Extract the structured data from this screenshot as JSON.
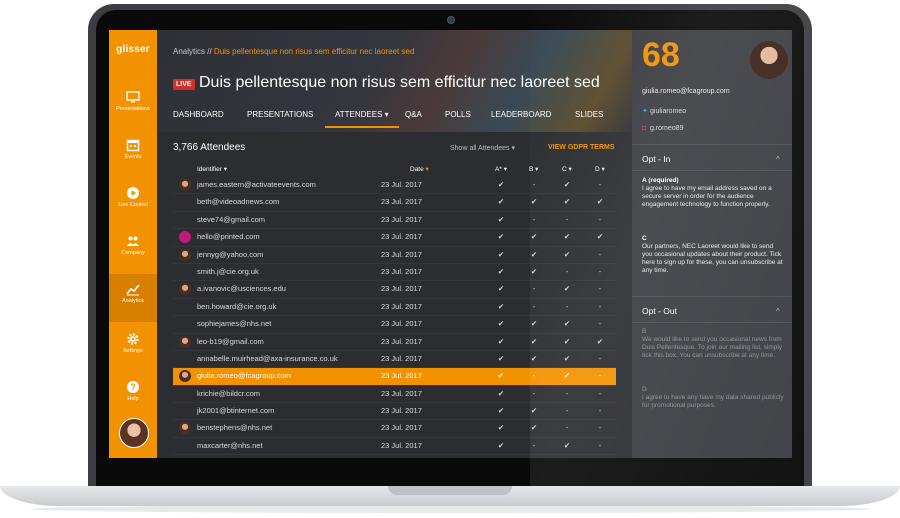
{
  "app": {
    "logo": "glisser"
  },
  "sidebar": {
    "items": [
      {
        "label": "Presentations",
        "icon": "monitor-icon"
      },
      {
        "label": "Events",
        "icon": "calendar-icon"
      },
      {
        "label": "Live Control",
        "icon": "play-icon"
      },
      {
        "label": "Company",
        "icon": "users-icon"
      },
      {
        "label": "Analytics",
        "icon": "chart-icon",
        "active": true
      },
      {
        "label": "Settings",
        "icon": "gear-icon"
      },
      {
        "label": "Help",
        "icon": "help-icon"
      }
    ]
  },
  "header": {
    "breadcrumb_root": "Analytics //",
    "breadcrumb_current": "Duis pellentesque non risus sem efficitur nec laoreet sed",
    "live_badge": "LIVE",
    "title": "Duis pellentesque non risus sem efficitur nec laoreet sed"
  },
  "tabs": [
    {
      "label": "DASHBOARD"
    },
    {
      "label": "PRESENTATIONS"
    },
    {
      "label": "ATTENDEES ▾",
      "active": true
    },
    {
      "label": "Q&A"
    },
    {
      "label": "POLLS"
    },
    {
      "label": "LEADERBOARD"
    },
    {
      "label": "SLIDES"
    }
  ],
  "attendees": {
    "count_label": "3,766 Attendees",
    "filter_label": "Show all Attendees ▾",
    "gdpr_link": "VIEW GDPR TERMS",
    "columns": {
      "identifier": "Identifier",
      "date": "Date",
      "a": "A*",
      "b": "B",
      "c": "C",
      "d": "D"
    },
    "rows": [
      {
        "identifier": "james.eastern@activateevents.com",
        "date": "23 Jul. 2017",
        "a": "✔",
        "b": "-",
        "c": "✔",
        "d": "-",
        "avatar": "photo"
      },
      {
        "identifier": "beth@videoadnews.com",
        "date": "23 Jul. 2017",
        "a": "✔",
        "b": "✔",
        "c": "✔",
        "d": "✔"
      },
      {
        "identifier": "steve74@gmail.com",
        "date": "23 Jul. 2017",
        "a": "✔",
        "b": "-",
        "c": "-",
        "d": "-"
      },
      {
        "identifier": "hello@printed.com",
        "date": "23 Jul. 2017",
        "a": "✔",
        "b": "✔",
        "c": "✔",
        "d": "✔",
        "avatar": "brand"
      },
      {
        "identifier": "jennyg@yahoo.com",
        "date": "23 Jul. 2017",
        "a": "✔",
        "b": "✔",
        "c": "✔",
        "d": "-",
        "avatar": "photo"
      },
      {
        "identifier": "smith.j@cie.org.uk",
        "date": "23 Jul. 2017",
        "a": "✔",
        "b": "✔",
        "c": "-",
        "d": "-"
      },
      {
        "identifier": "a.ivanovic@usciences.edu",
        "date": "23 Jul. 2017",
        "a": "✔",
        "b": "-",
        "c": "✔",
        "d": "-",
        "avatar": "photo"
      },
      {
        "identifier": "ben.howard@cie.org.uk",
        "date": "23 Jul. 2017",
        "a": "✔",
        "b": "-",
        "c": "-",
        "d": "-"
      },
      {
        "identifier": "sophiejames@nhs.net",
        "date": "23 Jul. 2017",
        "a": "✔",
        "b": "✔",
        "c": "✔",
        "d": "-"
      },
      {
        "identifier": "leo-b19@gmail.com",
        "date": "23 Jul. 2017",
        "a": "✔",
        "b": "✔",
        "c": "✔",
        "d": "✔",
        "avatar": "photo"
      },
      {
        "identifier": "annabelle.muirhead@axa-insurance.co.uk",
        "date": "23 Jul. 2017",
        "a": "✔",
        "b": "✔",
        "c": "✔",
        "d": "-"
      },
      {
        "identifier": "giulia.romeo@fcagroup.com",
        "date": "23 Jul. 2017",
        "a": "✔",
        "b": "-",
        "c": "✔",
        "d": "-",
        "avatar": "photo",
        "selected": true
      },
      {
        "identifier": "krichie@bildcr.com",
        "date": "23 Jul. 2017",
        "a": "✔",
        "b": "-",
        "c": "-",
        "d": "-"
      },
      {
        "identifier": "jk2001@btinternet.com",
        "date": "23 Jul. 2017",
        "a": "✔",
        "b": "✔",
        "c": "-",
        "d": "-"
      },
      {
        "identifier": "benstephens@nhs.net",
        "date": "23 Jul. 2017",
        "a": "✔",
        "b": "✔",
        "c": "-",
        "d": "-",
        "avatar": "photo"
      },
      {
        "identifier": "maxcarter@nhs.net",
        "date": "23 Jul. 2017",
        "a": "✔",
        "b": "-",
        "c": "✔",
        "d": "-"
      }
    ]
  },
  "profile": {
    "score": "68",
    "email": "giulia.romeo@fcagroup.com",
    "twitter": "giuliaromeo",
    "instagram": "g.romeo89"
  },
  "opt_in": {
    "title": "Opt - In",
    "items": [
      {
        "head": "A (required)",
        "text": "I agree to have my email address saved on a secure server in order for the audience engagement technology to function properly."
      },
      {
        "head": "C",
        "text": "Our partners, NEC Laoreet would like to send you occasional updates about their product. Tick here to sign up for these, you can unsubscribe at any time."
      }
    ]
  },
  "opt_out": {
    "title": "Opt - Out",
    "items": [
      {
        "head": "B",
        "text": "We would like to send you occasional news from Duis Pellentesque. To join our mailing list, simply tick this box. You can unsubscribe at any time."
      },
      {
        "head": "D",
        "text": "I agree to have any have my data shared publicly for promotional purposes."
      }
    ]
  },
  "colors": {
    "accent": "#f39200",
    "live": "#d0302b",
    "panel": "#3b3d42",
    "main": "#2b2d31"
  }
}
